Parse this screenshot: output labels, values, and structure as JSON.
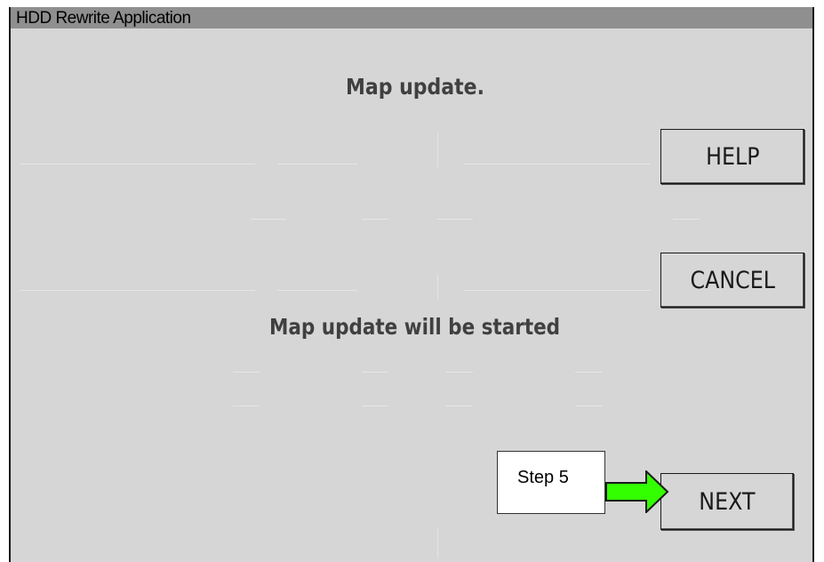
{
  "window": {
    "title": "HDD Rewrite Application"
  },
  "main": {
    "heading": "Map update.",
    "message": "Map update will be started"
  },
  "buttons": {
    "help_label": "HELP",
    "cancel_label": "CANCEL",
    "next_label": "NEXT"
  },
  "annotation": {
    "step_label": "Step 5",
    "arrow_icon": "right-arrow-icon",
    "arrow_color": "#33ff00"
  },
  "colors": {
    "window_bg": "#d6d6d6",
    "titlebar_bg": "#8f8f8f",
    "text": "#404040"
  }
}
